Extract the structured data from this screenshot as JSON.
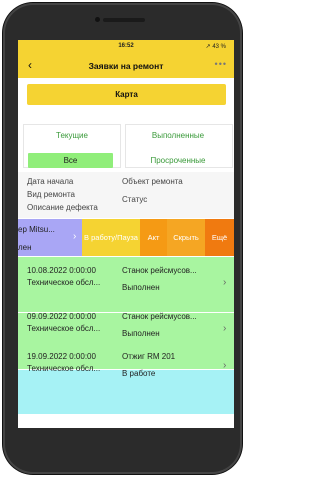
{
  "status_bar": {
    "time": "16:52",
    "right": "↗ 43 %"
  },
  "header": {
    "back_icon": "chevron-left-icon",
    "title": "Заявки на ремонт",
    "menu_icon": "more-icon"
  },
  "map_button": "Карта",
  "tabs": {
    "current": "Текущие",
    "done": "Выполненные",
    "all": "Все",
    "overdue": "Просроченные"
  },
  "filters": {
    "start_date": "Дата начала",
    "repair_type": "Вид ремонта",
    "defect_desc": "Описание дефекта",
    "object": "Объект ремонта",
    "status": "Статус"
  },
  "swiped_row": {
    "line1": "ер Mitsu...",
    "line2": "лен"
  },
  "actions": [
    {
      "label": "В работу/Пауза",
      "color": "#f5d332"
    },
    {
      "label": "Акт",
      "color": "#f59a14"
    },
    {
      "label": "Скрыть",
      "color": "#f5a623"
    },
    {
      "label": "Ещё",
      "color": "#f07a10"
    }
  ],
  "rows": [
    {
      "date": "10.08.2022 0:00:00",
      "type": "Техническое обсл...",
      "object": "Станок рейсмусов...",
      "status": "Выполнен",
      "color": "#a8f5a0"
    },
    {
      "date": "09.09.2022 0:00:00",
      "type": "Техническое обсл...",
      "object": "Станок рейсмусов...",
      "status": "Выполнен",
      "color": "#a8f5a0"
    },
    {
      "date": "19.09.2022 0:00:00",
      "type": "Техническое обсл...",
      "object": "Отжиг RM 201",
      "status": "В работе",
      "color": "#a6f2f5"
    }
  ]
}
